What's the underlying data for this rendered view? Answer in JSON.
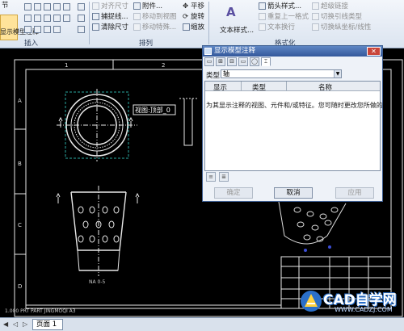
{
  "ribbon": {
    "left_cut_label": "节",
    "big_button_label": "显示模型注释",
    "insert_group": "插入",
    "arrange_group": "排列",
    "format_group": "格式化",
    "arrange": {
      "align_size": "对齐尺寸",
      "snap_line": "捕捉线...",
      "clear_size": "清除尺寸",
      "attach": "附件...",
      "move_to_view": "移动到视图",
      "move_special": "移动特殊...",
      "pan": "平移",
      "rotate": "旋转",
      "scale": "缩放"
    },
    "format": {
      "text_style_button": "文本样式...",
      "arrow_style": "箭头样式...",
      "repeat_last_format": "重复上一格式",
      "text_wrap": "文本换行",
      "hyperlink": "超级链接",
      "toggle_line_type": "切换引线类型",
      "toggle_ordinate": "切换纵坐标/线性"
    }
  },
  "dialog": {
    "title": "显示模型注释",
    "tabs": [
      "▭",
      "⊞",
      "⊟",
      "▭",
      "◯",
      "⌶"
    ],
    "type_label": "类型",
    "type_value": "轴",
    "columns": [
      "显示",
      "类型",
      "名称"
    ],
    "hint": "为其显示注释的视图、元件和/或特征。您可随时更改您所做的",
    "ok": "确定",
    "cancel": "取消",
    "apply": "应用"
  },
  "drawing": {
    "view_label": "视图:顶部_0",
    "col_labels": [
      "1",
      "2",
      "3"
    ],
    "row_labels": [
      "A",
      "B",
      "C",
      "D"
    ],
    "bottom_text": "1.000  PRT PART  JINGMOQI  A3",
    "caption": "NA 0-5"
  },
  "sheet": {
    "tab_label": "页面 1"
  },
  "watermark": {
    "main": "CAD自学网",
    "url": "WWW.CADZJ.COM"
  },
  "colors": {
    "background": "#000000",
    "drawing_lines": "#e8e8e8",
    "dialog_title": "#34589b",
    "selected_view": "#2aa8a0"
  }
}
